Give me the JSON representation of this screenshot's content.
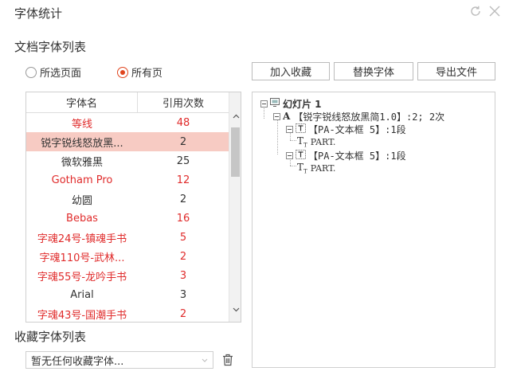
{
  "window": {
    "title": "字体统计"
  },
  "doc_section": {
    "label": "文档字体列表"
  },
  "scope": {
    "selected_pages": "所选页面",
    "all_pages": "所有页",
    "active": "all"
  },
  "toolbar": {
    "add_fav": "加入收藏",
    "replace_font": "替换字体",
    "export_file": "导出文件"
  },
  "table": {
    "headers": [
      "字体名",
      "引用次数"
    ],
    "rows": [
      {
        "name": "等线",
        "count": "48",
        "color": "red"
      },
      {
        "name": "锐字锐线怒放黑...",
        "count": "2",
        "color": "dark",
        "selected": true
      },
      {
        "name": "微软雅黑",
        "count": "25",
        "color": "dark"
      },
      {
        "name": "Gotham Pro",
        "count": "12",
        "color": "red"
      },
      {
        "name": "幼圆",
        "count": "2",
        "color": "dark"
      },
      {
        "name": "Bebas",
        "count": "16",
        "color": "red"
      },
      {
        "name": "字魂24号-镇魂手书",
        "count": "5",
        "color": "red"
      },
      {
        "name": "字魂110号-武林...",
        "count": "2",
        "color": "red"
      },
      {
        "name": "字魂55号-龙吟手书",
        "count": "3",
        "color": "red"
      },
      {
        "name": "Arial",
        "count": "3",
        "color": "dark"
      },
      {
        "name": "字魂43号-国潮手书",
        "count": "2",
        "color": "red"
      }
    ]
  },
  "tree": {
    "slide": "幻灯片 1",
    "font_node": "【锐字锐线怒放黑简1.0】:2; 2次",
    "textbox_a": "【PA-文本框 5】:1段",
    "text_a": "PART.",
    "textbox_b": "【PA-文本框 5】:1段",
    "text_b": "PART."
  },
  "fav_section": {
    "label": "收藏字体列表",
    "combo_value": "暂无任何收藏字体..."
  },
  "colors": {
    "accent": "#e0451e",
    "red_text": "#e02b2b",
    "selected_row": "#f7cbc3"
  }
}
